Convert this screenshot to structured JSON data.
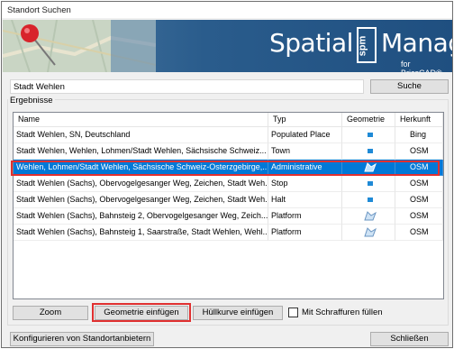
{
  "window": {
    "title": "Standort Suchen"
  },
  "banner": {
    "brand_part1": "Spatial",
    "brand_badge": "spm",
    "brand_part2": "Manager",
    "brand_sub": "for BricsCAD®"
  },
  "search": {
    "value": "Stadt Wehlen",
    "button_label": "Suche"
  },
  "results": {
    "group_label": "Ergebnisse",
    "columns": [
      "Name",
      "Typ",
      "Geometrie",
      "Herkunft"
    ],
    "rows": [
      {
        "name": "Stadt Wehlen, SN, Deutschland",
        "type": "Populated Place",
        "geometry": "point",
        "source": "Bing"
      },
      {
        "name": "Stadt Wehlen, Wehlen, Lohmen/Stadt Wehlen, Sächsische Schweiz...",
        "type": "Town",
        "geometry": "point",
        "source": "OSM"
      },
      {
        "name": "Wehlen, Lohmen/Stadt Wehlen, Sächsische Schweiz-Osterzgebirge,...",
        "type": "Administrative",
        "geometry": "polygon",
        "source": "OSM"
      },
      {
        "name": "Stadt Wehlen (Sachs), Obervogelgesanger Weg, Zeichen, Stadt Weh...",
        "type": "Stop",
        "geometry": "point",
        "source": "OSM"
      },
      {
        "name": "Stadt Wehlen (Sachs), Obervogelgesanger Weg, Zeichen, Stadt Weh...",
        "type": "Halt",
        "geometry": "point",
        "source": "OSM"
      },
      {
        "name": "Stadt Wehlen (Sachs), Bahnsteig 2, Obervogelgesanger Weg, Zeich...",
        "type": "Platform",
        "geometry": "polygon",
        "source": "OSM"
      },
      {
        "name": "Stadt Wehlen (Sachs), Bahnsteig 1, Saarstraße, Stadt Wehlen, Wehl...",
        "type": "Platform",
        "geometry": "polygon",
        "source": "OSM"
      }
    ]
  },
  "actions": {
    "zoom": "Zoom",
    "insert_geometry": "Geometrie einfügen",
    "insert_hull": "Hüllkurve einfügen",
    "hatch_checkbox_label": "Mit Schraffuren füllen",
    "hatch_checked": false
  },
  "footer": {
    "configure": "Konfigurieren von Standortanbietern",
    "close": "Schließen"
  },
  "colors": {
    "selection": "#0078d7",
    "highlight_border": "#e03030",
    "banner": "#2a5c8c"
  }
}
